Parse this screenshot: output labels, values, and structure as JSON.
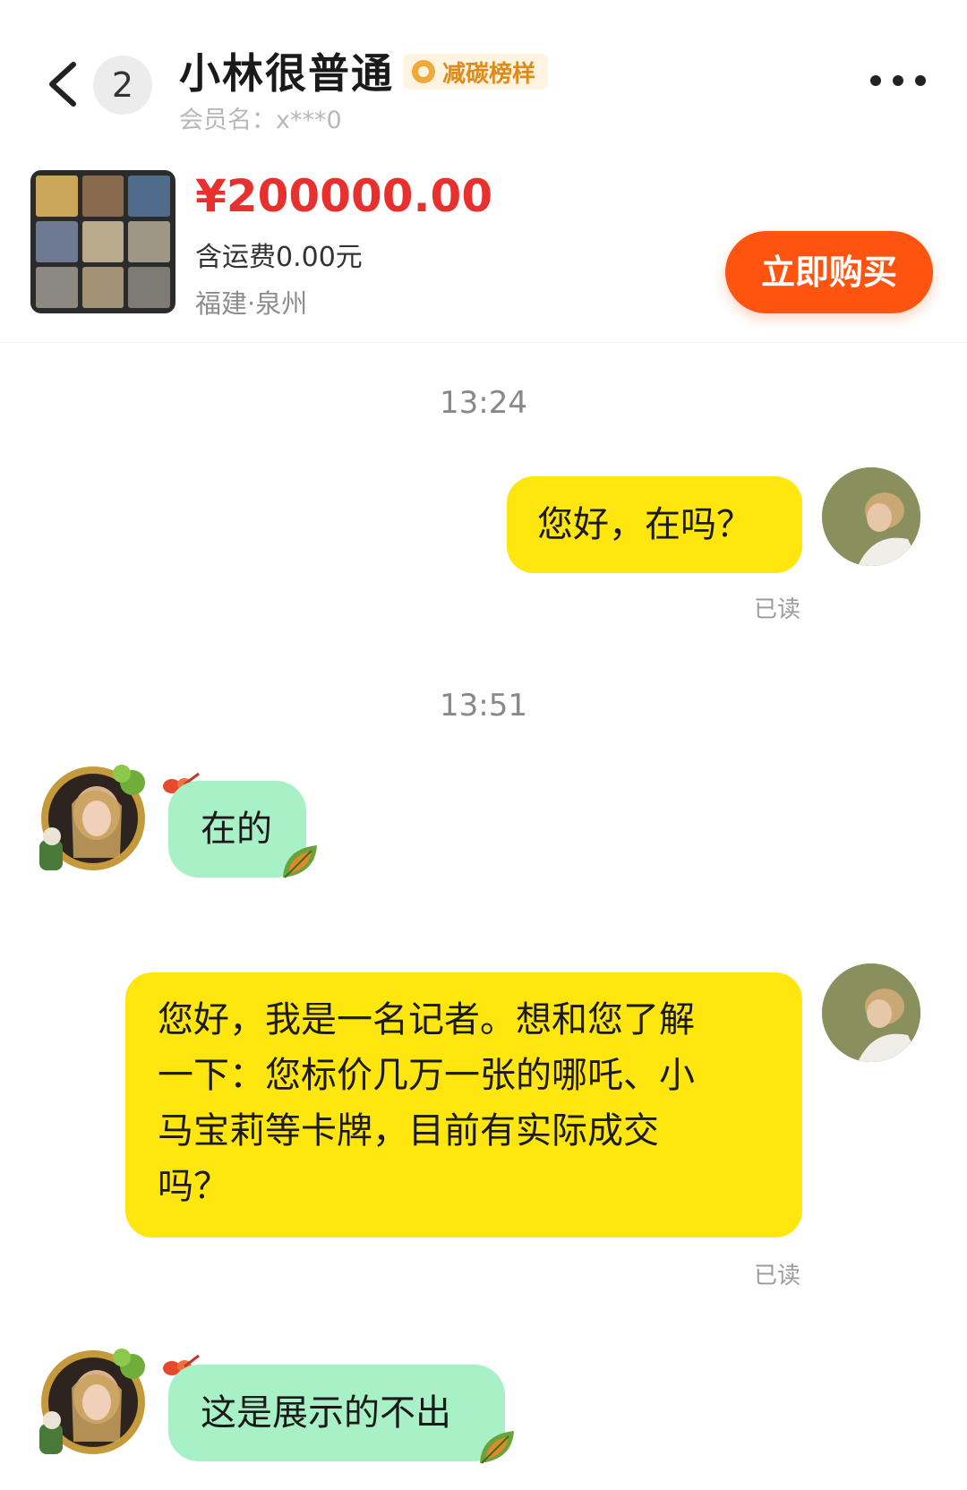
{
  "header": {
    "unread_count": "2",
    "title": "小林很普通",
    "tag_label": "减碳榜样",
    "member_label": "会员名：",
    "member_value": "x***0"
  },
  "product": {
    "price": "¥200000.00",
    "shipping": "含运费0.00元",
    "location": "福建·泉州",
    "buy_label": "立即购买"
  },
  "chat": {
    "time1": "13:24",
    "msg1": "您好，在吗？",
    "read1": "已读",
    "time2": "13:51",
    "msg2": "在的",
    "msg3_lines": [
      "您好，我是一名记者。想和您了解",
      "一下：您标价几万一张的哪吒、小",
      "马宝莉等卡牌，目前有实际成交",
      "吗？"
    ],
    "read2": "已读",
    "msg4": "这是展示的不出"
  },
  "colors": {
    "accent": "#ff5410",
    "price": "#e8312f",
    "self_bubble": "#ffe60f",
    "other_bubble": "#a8f0c6"
  },
  "icons": [
    "back-icon",
    "more-icon",
    "carbon-tag-icon",
    "leaf-icon",
    "butterfly-icon"
  ]
}
